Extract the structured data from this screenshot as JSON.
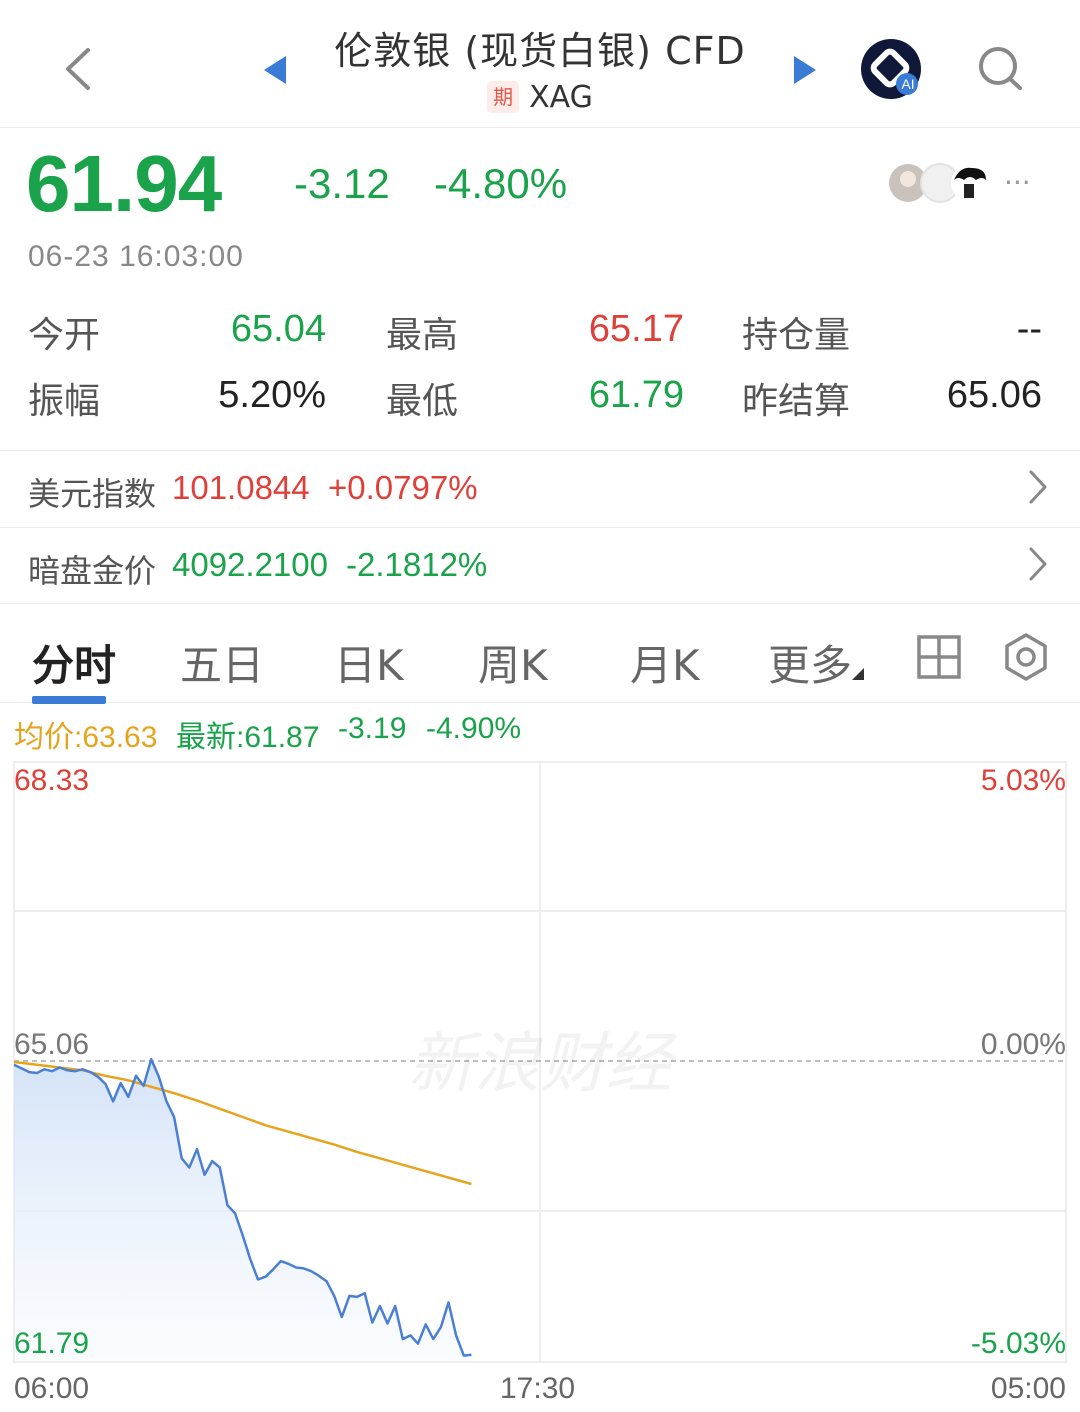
{
  "header": {
    "title": "伦敦银 (现货白银) CFD",
    "badge": "期",
    "symbol": "XAG",
    "ai_label": "AI"
  },
  "quote": {
    "price": "61.94",
    "change": "-3.12",
    "change_pct": "-4.80%",
    "timestamp": "06-23 16:03:00",
    "more": "···"
  },
  "stats": [
    {
      "label": "今开",
      "value": "65.04",
      "color": "#1aa34a"
    },
    {
      "label": "最高",
      "value": "65.17",
      "color": "#e0403a"
    },
    {
      "label": "持仓量",
      "value": "--",
      "color": "#222222"
    },
    {
      "label": "振幅",
      "value": "5.20%",
      "color": "#222222"
    },
    {
      "label": "最低",
      "value": "61.79",
      "color": "#1aa34a"
    },
    {
      "label": "昨结算",
      "value": "65.06",
      "color": "#222222"
    }
  ],
  "indices": [
    {
      "label": "美元指数",
      "value": "101.0844",
      "change": "+0.0797%",
      "color": "#e0403a"
    },
    {
      "label": "暗盘金价",
      "value": "4092.2100",
      "change": "-2.1812%",
      "color": "#1aa34a"
    }
  ],
  "tabs": [
    "分时",
    "五日",
    "日K",
    "周K",
    "月K",
    "更多"
  ],
  "chart_info": {
    "avg": "均价:63.63",
    "latest": "最新:61.87",
    "change": "-3.19",
    "change_pct": "-4.90%"
  },
  "chart_data": {
    "type": "line",
    "y_top": "68.33",
    "y_mid": "65.06",
    "y_bottom": "61.79",
    "pct_top": "5.03%",
    "pct_mid": "0.00%",
    "pct_bottom": "-5.03%",
    "x_labels": [
      "06:00",
      "17:30",
      "05:00"
    ],
    "watermark": "新浪财经",
    "ylim": [
      61.79,
      68.33
    ],
    "x_domain": [
      0,
      1380
    ],
    "series": [
      {
        "x": [
          0,
          10,
          20,
          30,
          40,
          50,
          60,
          70,
          80,
          90,
          100,
          110,
          120,
          130,
          140,
          150,
          160,
          170,
          180,
          190,
          200,
          210,
          220,
          230,
          240,
          250,
          260,
          270,
          280,
          290,
          300,
          310,
          320,
          330,
          340,
          350,
          360,
          370,
          380,
          390,
          400,
          410,
          420,
          430,
          440,
          450,
          460,
          470,
          480,
          490,
          500,
          510,
          520,
          530,
          540,
          550,
          560,
          570,
          580,
          590,
          600
        ],
        "values": [
          65.03,
          64.99,
          64.95,
          64.94,
          64.98,
          64.96,
          65.0,
          64.97,
          64.96,
          64.98,
          64.95,
          64.9,
          64.82,
          64.63,
          64.83,
          64.68,
          64.91,
          64.8,
          65.09,
          64.9,
          64.63,
          64.46,
          64.01,
          63.91,
          64.11,
          63.83,
          63.98,
          63.91,
          63.5,
          63.41,
          63.17,
          62.91,
          62.69,
          62.72,
          62.8,
          62.89,
          62.86,
          62.82,
          62.81,
          62.78,
          62.73,
          62.67,
          62.51,
          62.28,
          62.51,
          62.5,
          62.54,
          62.22,
          62.4,
          62.21,
          62.4,
          62.04,
          62.08,
          61.99,
          62.2,
          62.04,
          62.17,
          62.44,
          62.08,
          61.86,
          61.87
        ]
      },
      {
        "x": [
          0,
          30,
          60,
          90,
          120,
          150,
          180,
          210,
          240,
          270,
          300,
          330,
          360,
          390,
          420,
          450,
          480,
          510,
          540,
          570,
          600
        ],
        "values": [
          65.06,
          65.03,
          65.0,
          64.97,
          64.91,
          64.86,
          64.79,
          64.72,
          64.64,
          64.55,
          64.46,
          64.37,
          64.3,
          64.23,
          64.16,
          64.08,
          64.01,
          63.94,
          63.87,
          63.8,
          63.73
        ]
      }
    ]
  },
  "colors": {
    "up": "#e0403a",
    "down": "#1aa34a",
    "avg_line": "#e6a41e",
    "price_line": "#4a7fd4",
    "tab_underline": "#3a7bd5"
  }
}
